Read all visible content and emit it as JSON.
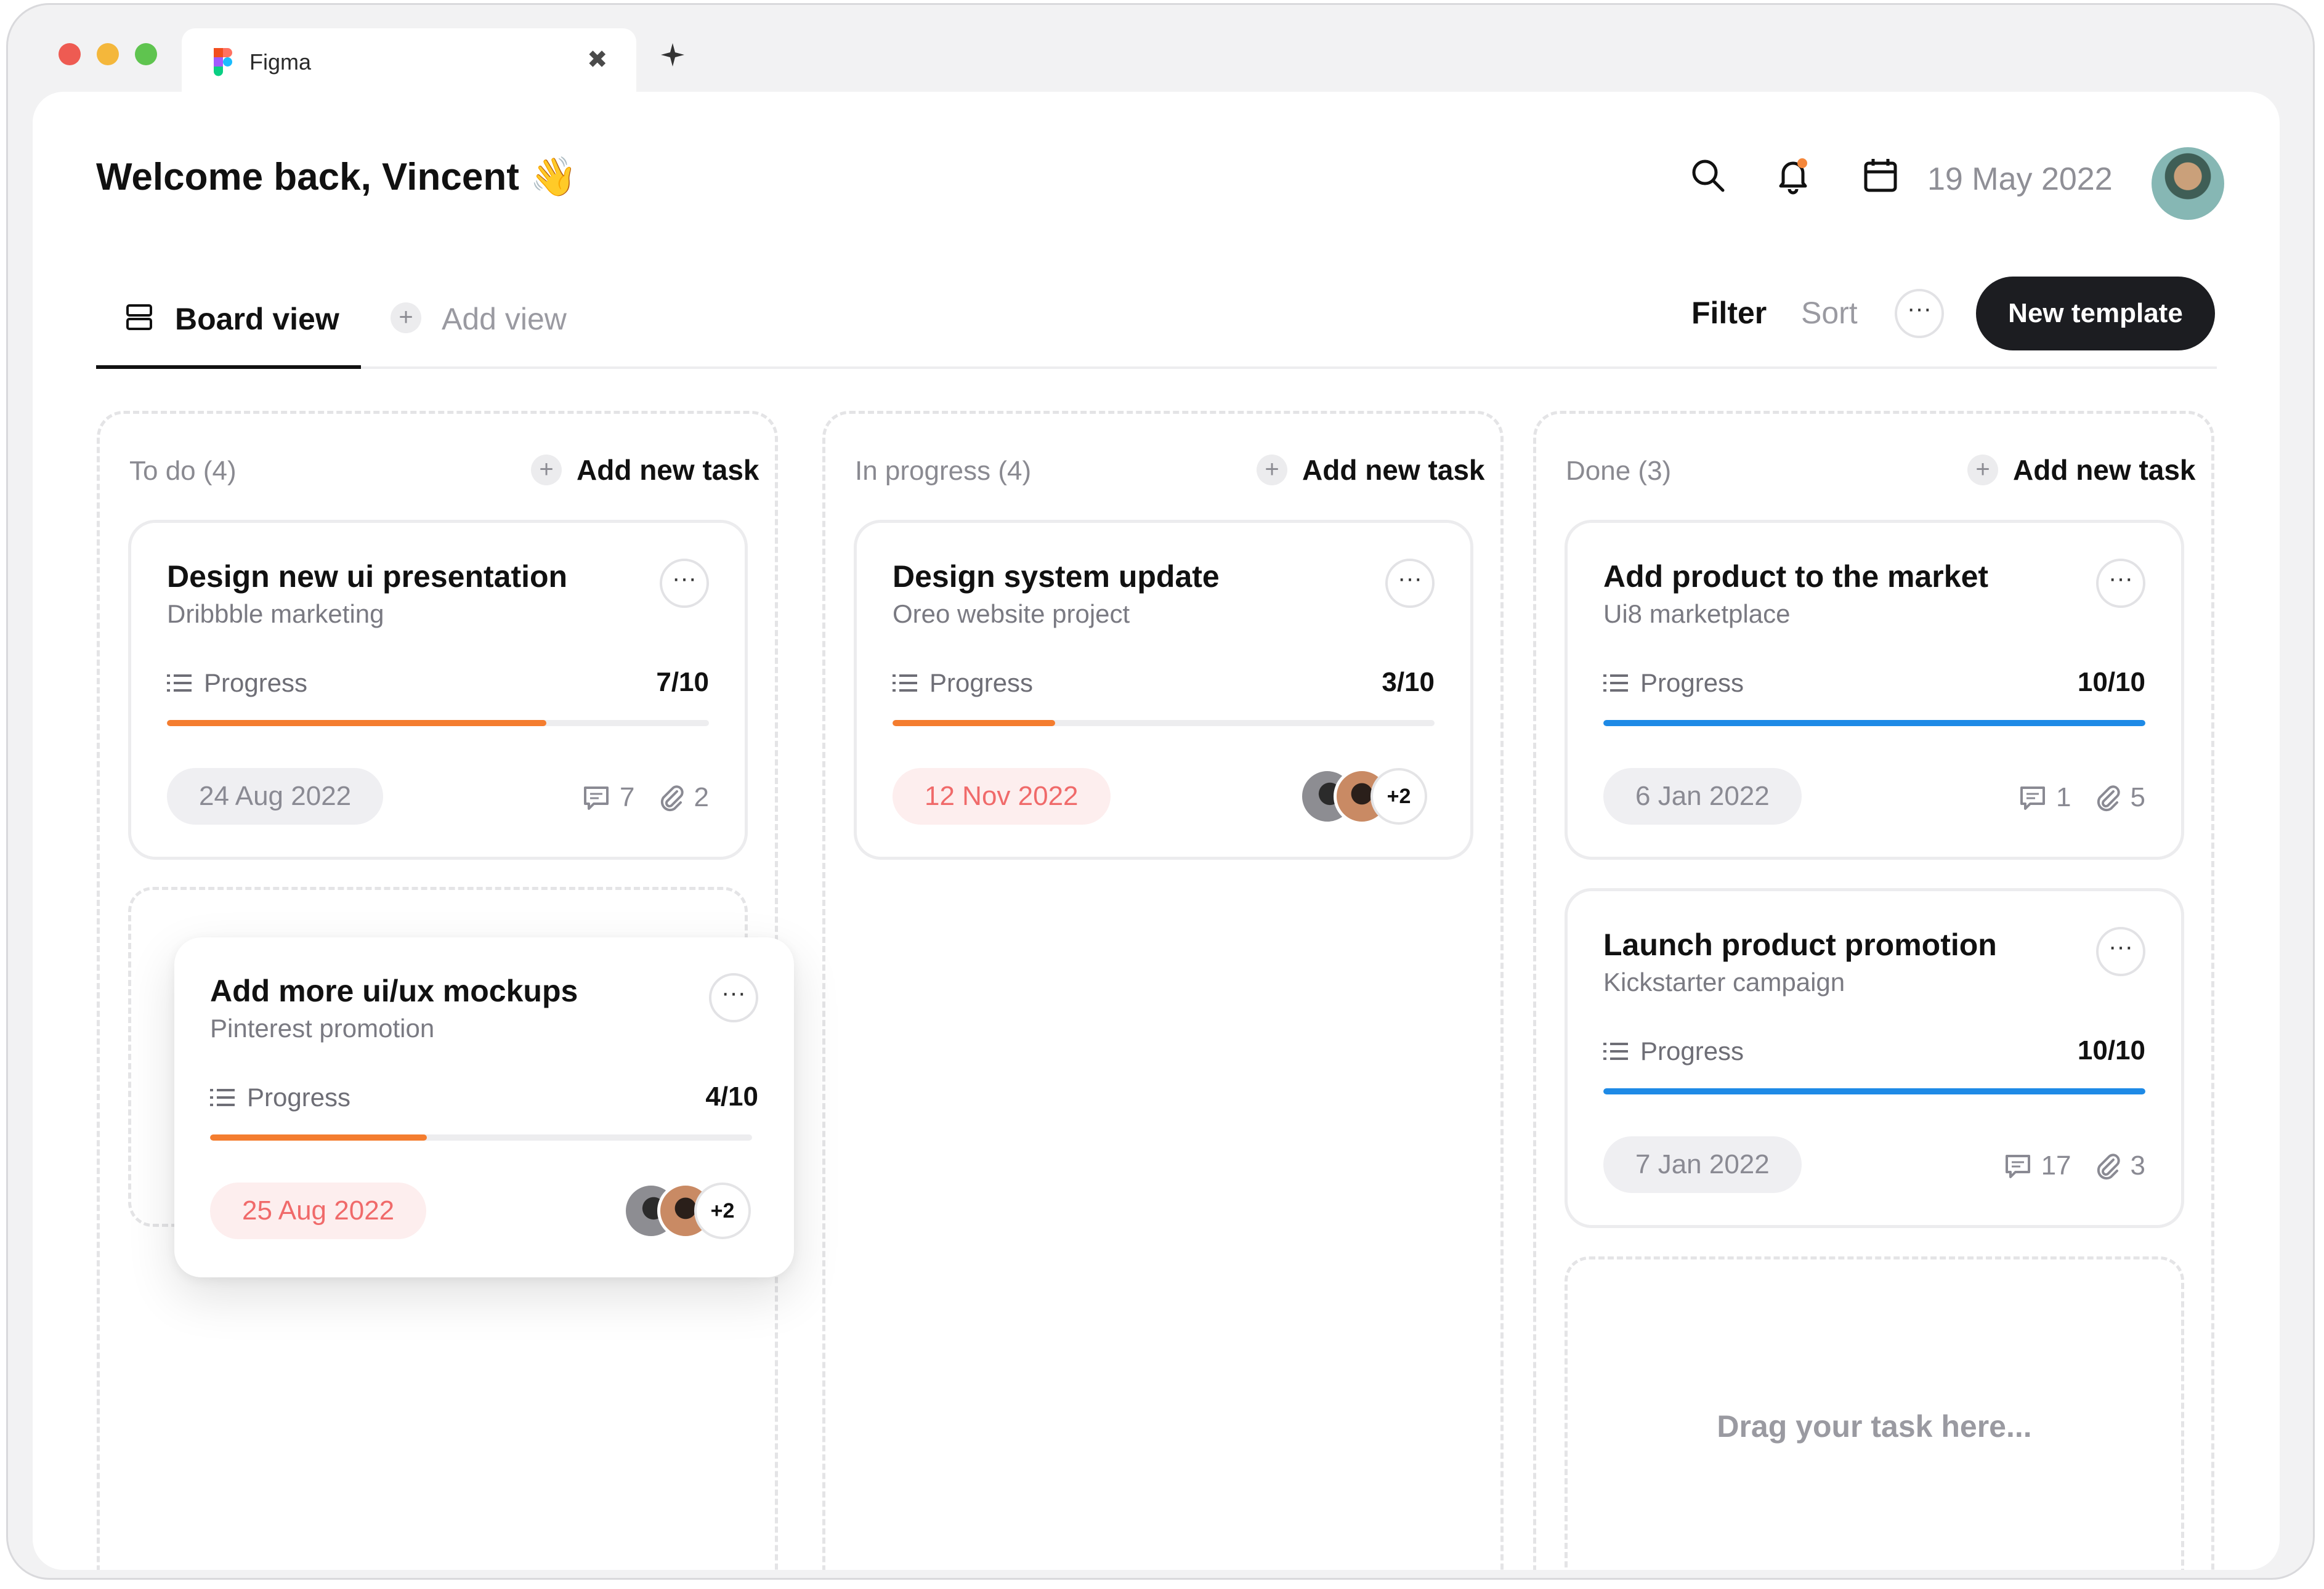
{
  "browser": {
    "tab_title": "Figma",
    "close_glyph": "✖",
    "new_tab_glyph": "+"
  },
  "header": {
    "welcome": "Welcome back, Vincent 👋",
    "date": "19 May 2022",
    "icons": [
      "search-icon",
      "bell-icon",
      "calendar-icon"
    ],
    "notification_dot_color": "#f5873a"
  },
  "viewbar": {
    "board_view": "Board view",
    "add_view": "Add view",
    "filter": "Filter",
    "sort": "Sort",
    "more": "···",
    "new_template": "New template"
  },
  "common": {
    "add_task": "Add new task",
    "progress_label": "Progress",
    "more": "···",
    "plus": "+"
  },
  "colors": {
    "orange_progress": "#f47d2f",
    "blue_progress": "#1e8ae6",
    "primary_button": "#1c1d21"
  },
  "columns": [
    {
      "title": "To do (4)",
      "cards": [
        {
          "title": "Design new ui presentation",
          "subtitle": "Dribbble marketing",
          "progress": "7/10",
          "progress_fraction": 0.7,
          "progress_color": "orange",
          "date": "24 Aug 2022",
          "date_style": "grey",
          "comments": "7",
          "attachments": "2"
        },
        {
          "title": "Add more ui/ux mockups",
          "subtitle": "Pinterest promotion",
          "progress": "4/10",
          "progress_fraction": 0.4,
          "progress_color": "orange",
          "date": "25 Aug 2022",
          "date_style": "red",
          "extra_members": "+2"
        }
      ]
    },
    {
      "title": "In progress (4)",
      "cards": [
        {
          "title": "Design system update",
          "subtitle": "Oreo website project",
          "progress": "3/10",
          "progress_fraction": 0.3,
          "progress_color": "orange",
          "date": "12 Nov 2022",
          "date_style": "red",
          "extra_members": "+2"
        }
      ]
    },
    {
      "title": "Done (3)",
      "cards": [
        {
          "title": "Add product to the market",
          "subtitle": "Ui8 marketplace",
          "progress": "10/10",
          "progress_fraction": 1.0,
          "progress_color": "blue",
          "date": "6 Jan 2022",
          "date_style": "grey",
          "comments": "1",
          "attachments": "5"
        },
        {
          "title": "Launch product promotion",
          "subtitle": "Kickstarter campaign",
          "progress": "10/10",
          "progress_fraction": 1.0,
          "progress_color": "blue",
          "date": "7 Jan 2022",
          "date_style": "grey",
          "comments": "17",
          "attachments": "3"
        }
      ],
      "drop_text": "Drag your task here..."
    }
  ]
}
